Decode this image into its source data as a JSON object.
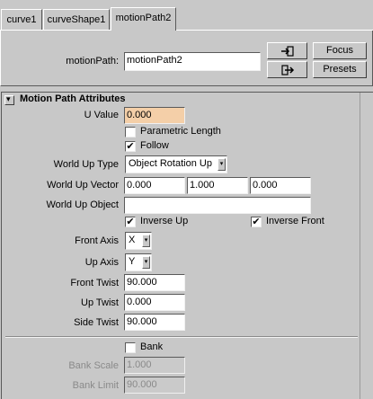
{
  "tabs": [
    "curve1",
    "curveShape1",
    "motionPath2"
  ],
  "header": {
    "label": "motionPath:",
    "value": "motionPath2",
    "focus": "Focus",
    "presets": "Presets"
  },
  "section": {
    "toggle": "▾",
    "title": "Motion Path Attributes"
  },
  "u_value": {
    "label": "U Value",
    "value": "0.000"
  },
  "parametric_length": {
    "label": "Parametric Length",
    "checked": false
  },
  "follow": {
    "label": "Follow",
    "checked": true,
    "mark": "✔"
  },
  "world_up_type": {
    "label": "World Up Type",
    "value": "Object Rotation Up"
  },
  "world_up_vector": {
    "label": "World Up Vector",
    "x": "0.000",
    "y": "1.000",
    "z": "0.000"
  },
  "world_up_object": {
    "label": "World Up Object",
    "value": ""
  },
  "inverse_up": {
    "label": "Inverse Up",
    "checked": true,
    "mark": "✔"
  },
  "inverse_front": {
    "label": "Inverse Front",
    "checked": true,
    "mark": "✔"
  },
  "front_axis": {
    "label": "Front Axis",
    "value": "X"
  },
  "up_axis": {
    "label": "Up Axis",
    "value": "Y"
  },
  "front_twist": {
    "label": "Front Twist",
    "value": "90.000"
  },
  "up_twist": {
    "label": "Up Twist",
    "value": "0.000"
  },
  "side_twist": {
    "label": "Side Twist",
    "value": "90.000"
  },
  "bank": {
    "label": "Bank",
    "checked": false
  },
  "bank_scale": {
    "label": "Bank Scale",
    "value": "1.000"
  },
  "bank_limit": {
    "label": "Bank Limit",
    "value": "90.000"
  },
  "arrow_glyph": "▾",
  "icons": [
    "load-attributes-icon",
    "copy-tab-icon",
    "section-collapse-icon"
  ]
}
